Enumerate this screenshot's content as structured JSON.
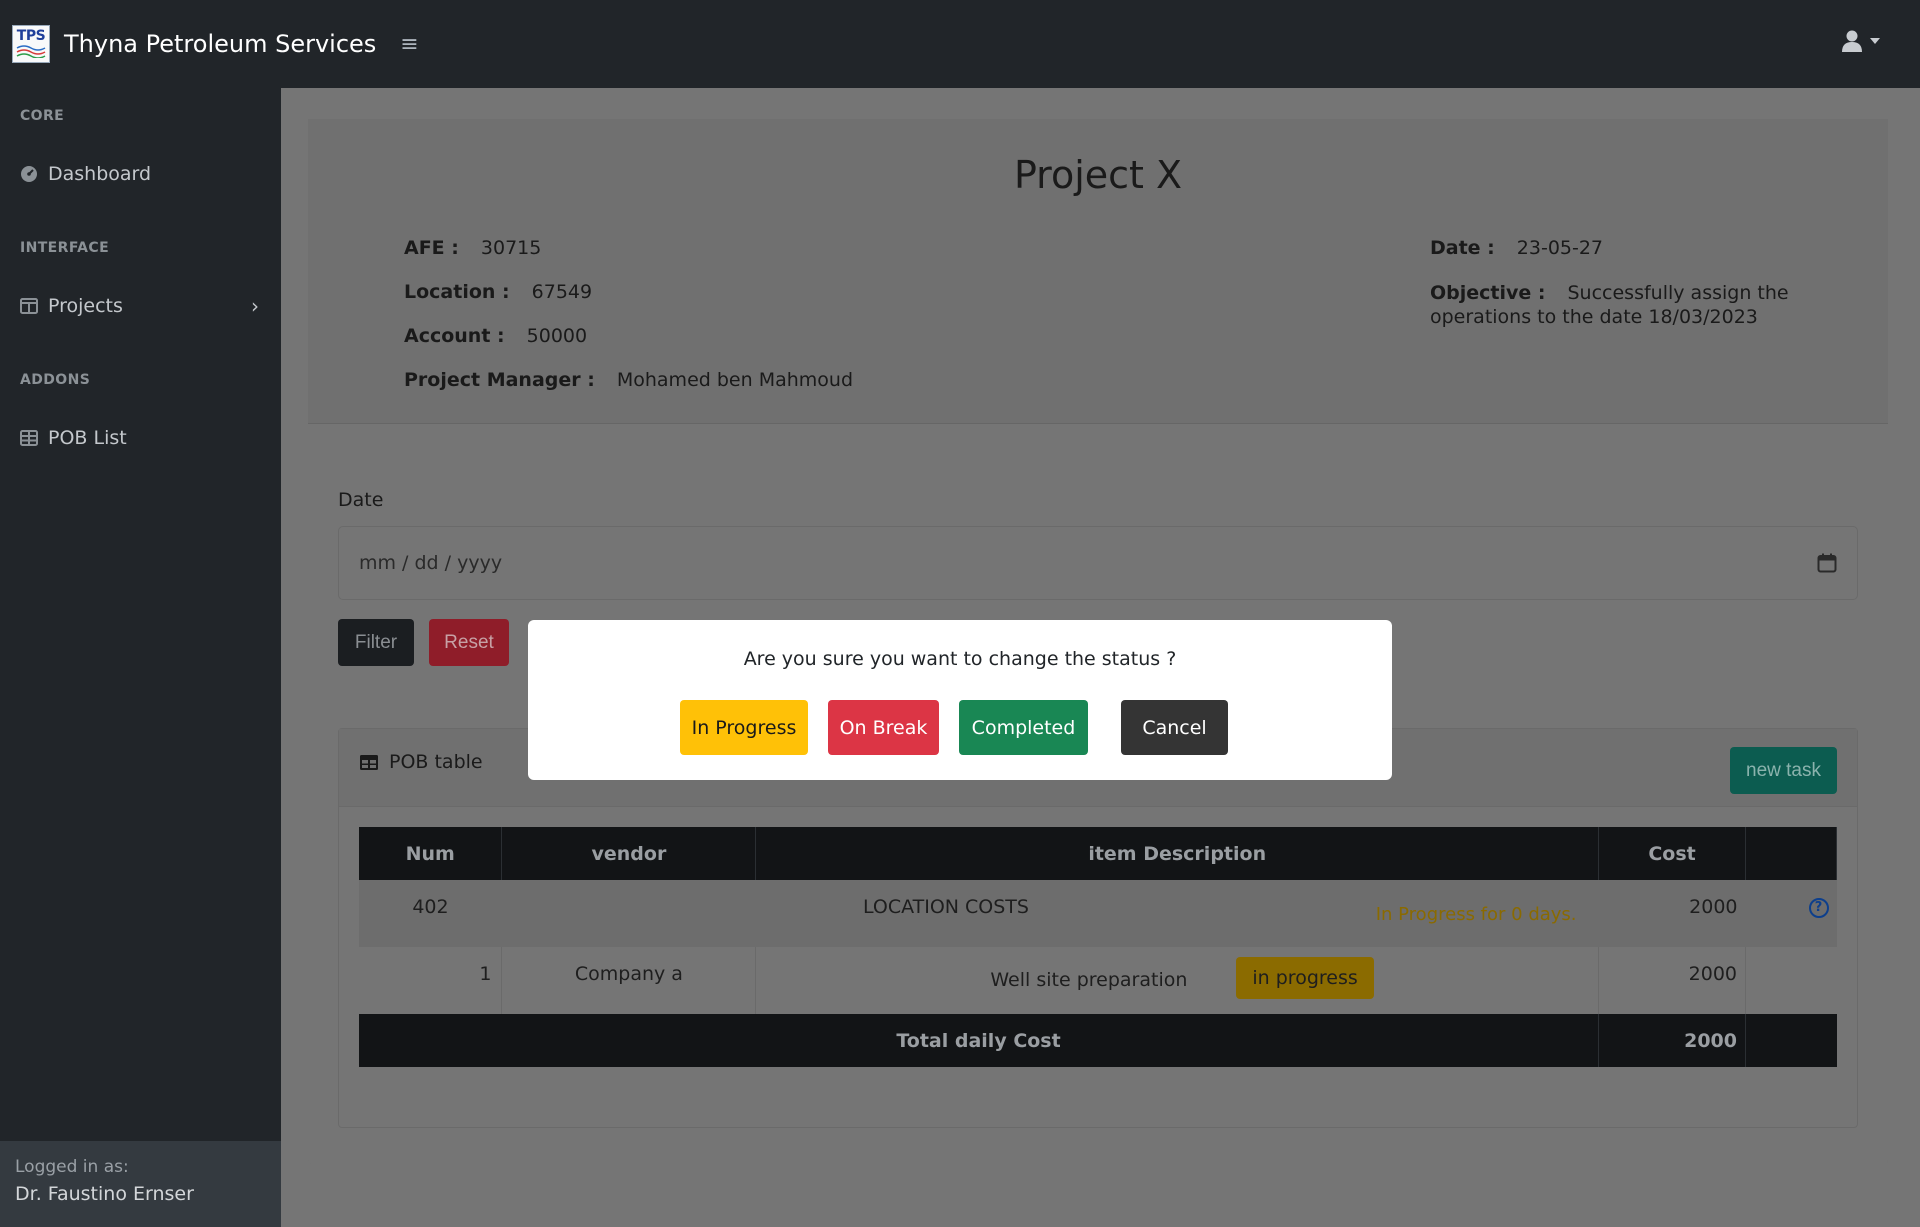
{
  "app": {
    "logo_text": "TPS",
    "title": "Thyna Petroleum Services"
  },
  "sidebar": {
    "sections": [
      {
        "heading": "CORE",
        "items": [
          {
            "label": "Dashboard",
            "icon": "dashboard-icon"
          }
        ]
      },
      {
        "heading": "INTERFACE",
        "items": [
          {
            "label": "Projects",
            "icon": "columns-icon"
          }
        ]
      },
      {
        "heading": "ADDONS",
        "items": [
          {
            "label": "POB List",
            "icon": "table-icon"
          }
        ]
      }
    ],
    "footer": {
      "logged_in_label": "Logged in as:",
      "user_name": "Dr. Faustino Ernser"
    }
  },
  "project": {
    "title": "Project X",
    "afe_label": "AFE :",
    "afe": "30715",
    "location_label": "Location :",
    "location": "67549",
    "account_label": "Account :",
    "account": "50000",
    "manager_label": "Project Manager :",
    "manager": "Mohamed ben Mahmoud",
    "date_label": "Date :",
    "date": "23-05-27",
    "objective_label": "Objective :",
    "objective": "Successfully assign the operations to the date 18/03/2023"
  },
  "filter": {
    "date_label": "Date",
    "date_placeholder": "mm / dd / yyyy",
    "filter_button": "Filter",
    "reset_button": "Reset"
  },
  "pob_table": {
    "title": "POB table",
    "new_task_button": "new task",
    "headers": [
      "Num",
      "vendor",
      "item Description",
      "Cost",
      ""
    ],
    "location_row": {
      "num": "402",
      "description": "LOCATION COSTS",
      "status": "In Progress for 0 days.",
      "cost": "2000",
      "help": "?"
    },
    "rows": [
      {
        "num": "1",
        "vendor": "Company a",
        "description": "Well site preparation",
        "status_badge": "in progress",
        "cost": "2000"
      }
    ],
    "total_label": "Total daily Cost",
    "total": "2000"
  },
  "modal": {
    "question": "Are you sure you want to change the status ?",
    "buttons": {
      "in_progress": "In Progress",
      "on_break": "On Break",
      "completed": "Completed",
      "cancel": "Cancel"
    }
  },
  "colors": {
    "navbar": "#212529",
    "in_progress": "#ffc107",
    "on_break": "#dc3545",
    "completed": "#198754",
    "cancel": "#343434"
  }
}
